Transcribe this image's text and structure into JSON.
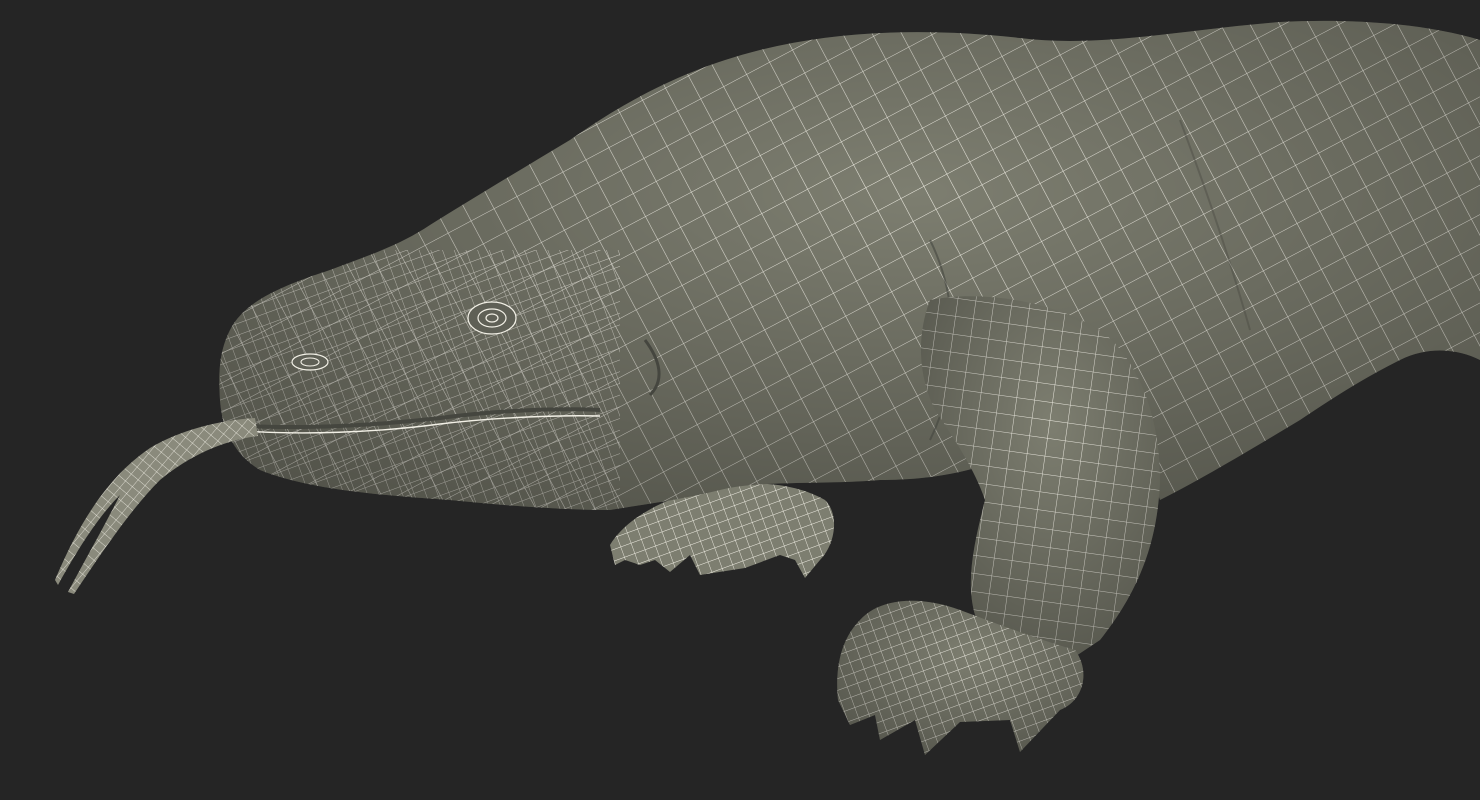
{
  "scene": {
    "subject": "komodo-dragon-wireframe",
    "colors": {
      "background": "#252525",
      "body_fill": "#7d7e70",
      "body_shade": "#5f6056",
      "body_dark": "#45463f",
      "wire": "#f2f0e6",
      "tongue_fill": "#8a8a7c"
    }
  }
}
